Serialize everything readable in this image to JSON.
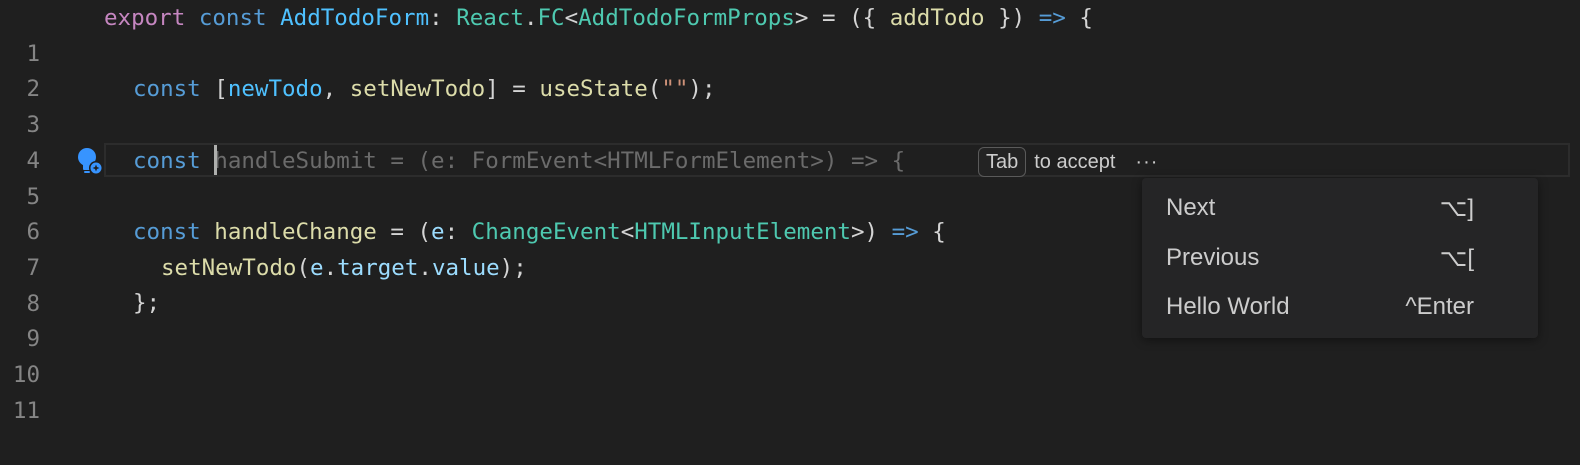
{
  "editor": {
    "line_numbers": [
      "1",
      "2",
      "3",
      "4",
      "5",
      "6",
      "7",
      "8",
      "9",
      "10",
      "11"
    ],
    "line1": {
      "export": "export",
      "const": "const",
      "name": "AddTodoForm",
      "colon": ": ",
      "react": "React",
      "dot": ".",
      "fc": "FC",
      "lt": "<",
      "props": "AddTodoFormProps",
      "gt_eq_paren": "> = ({ ",
      "param": "addTodo",
      "close": " }) ",
      "arrow": "=>",
      "brace": " {"
    },
    "line3": {
      "const": "const",
      "open": " [",
      "state": "newTodo",
      "comma": ", ",
      "setter": "setNewTodo",
      "close": "] = ",
      "hook": "useState",
      "paren_open": "(",
      "string": "\"\"",
      "paren_close": ");"
    },
    "line5": {
      "const": "const",
      "ghost_text": "handleSubmit = (e: FormEvent<HTMLFormElement>) => {"
    },
    "line7": {
      "const": "const",
      "name": "handleChange",
      "eq": " = (",
      "param": "e",
      "colon": ": ",
      "type": "ChangeEvent",
      "lt": "<",
      "el": "HTMLInputElement",
      "gt": ">) ",
      "arrow": "=>",
      "brace": " {"
    },
    "line8": {
      "call": "setNewTodo",
      "open": "(",
      "e": "e",
      "dot1": ".",
      "target": "target",
      "dot2": ".",
      "value": "value",
      "close": ");"
    },
    "line9": {
      "text": "};"
    }
  },
  "inline_suggestion": {
    "key": "Tab",
    "label": "to accept",
    "more": "···"
  },
  "suggestion_menu": {
    "items": [
      {
        "label": "Next",
        "shortcut": "⌥]"
      },
      {
        "label": "Previous",
        "shortcut": "⌥["
      },
      {
        "label": "Hello World",
        "shortcut": "^Enter"
      }
    ]
  },
  "colors": {
    "background": "#1f1f1f",
    "keyword_purple": "#c586c0",
    "keyword_blue": "#569cd6",
    "type_teal": "#4ec9b0",
    "function_yellow": "#dcdcaa",
    "variable_lightblue": "#9cdcfe",
    "string_orange": "#ce9178",
    "lightbulb_blue": "#3794ff"
  },
  "icons": {
    "lightbulb": "lightbulb-sparkle-icon"
  }
}
